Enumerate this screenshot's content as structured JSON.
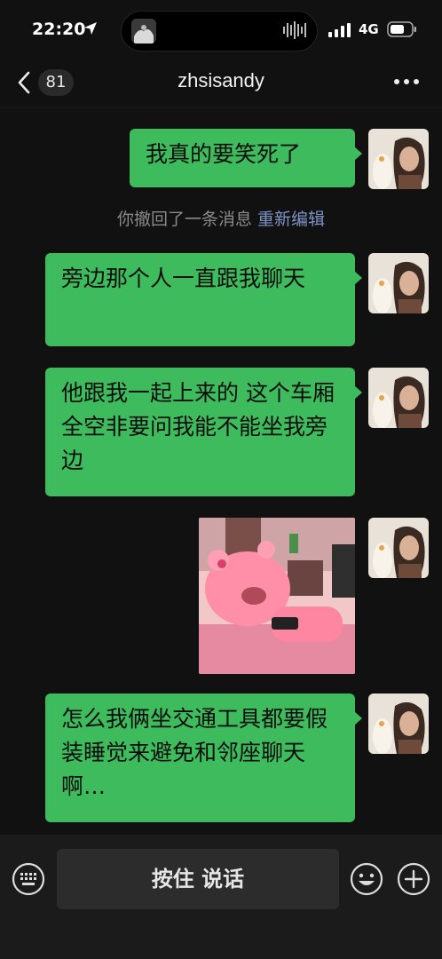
{
  "status_bar": {
    "time": "22:20",
    "network": "4G"
  },
  "nav": {
    "unread_count": "81",
    "title": "zhsisandy"
  },
  "messages": [
    {
      "type": "text",
      "text": "我真的要笑死了"
    },
    {
      "type": "text",
      "text": "旁边那个人一直跟我聊天"
    },
    {
      "type": "text",
      "text": "他跟我一起上来的 这个车厢全空非要问我能不能坐我旁边"
    },
    {
      "type": "sticker",
      "description": "pink-bear-sticker"
    },
    {
      "type": "text",
      "text": "怎么我俩坐交通工具都要假装睡觉来避免和邻座聊天啊…"
    }
  ],
  "system_notice": {
    "text": "你撤回了一条消息",
    "action": "重新编辑"
  },
  "input_bar": {
    "hold_to_talk": "按住 说话"
  },
  "colors": {
    "bubble_green": "#3ebb5c",
    "background": "#111111",
    "link_blue": "#7d93c7"
  },
  "icons": [
    "location-arrow-icon",
    "signal-bars-icon",
    "battery-icon",
    "back-chevron-icon",
    "more-dots-icon",
    "keyboard-icon",
    "emoji-icon",
    "plus-icon"
  ]
}
